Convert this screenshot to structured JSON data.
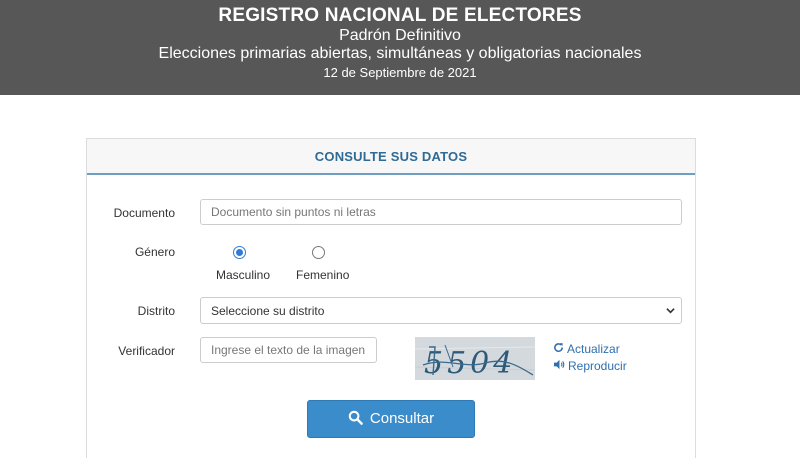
{
  "header": {
    "title": "REGISTRO NACIONAL DE ELECTORES",
    "subtitle": "Padrón Definitivo",
    "election": "Elecciones primarias abiertas, simultáneas y obligatorias nacionales",
    "date": "12 de Septiembre de 2021"
  },
  "form": {
    "heading": "CONSULTE SUS DATOS",
    "documento": {
      "label": "Documento",
      "placeholder": "Documento sin puntos ni letras",
      "value": ""
    },
    "genero": {
      "label": "Género",
      "options": [
        {
          "label": "Masculino",
          "selected": true
        },
        {
          "label": "Femenino",
          "selected": false
        }
      ]
    },
    "distrito": {
      "label": "Distrito",
      "selected": "Seleccione su distrito"
    },
    "verificador": {
      "label": "Verificador",
      "placeholder": "Ingrese el texto de la imagen",
      "value": "",
      "captcha_text": "5504",
      "refresh_label": "Actualizar",
      "refresh_icon": "refresh-icon",
      "play_label": "Reproducir",
      "play_icon": "volume-icon"
    },
    "submit": {
      "label": "Consultar",
      "icon": "search-icon"
    }
  },
  "colors": {
    "header_bg": "#575757",
    "accent": "#2f6a94",
    "button": "#3a8ccb",
    "link": "#2f6fae"
  }
}
